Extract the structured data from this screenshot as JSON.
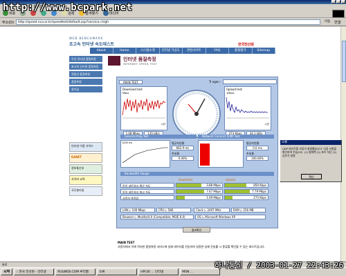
{
  "browser": {
    "menu": [
      "파일(F)",
      "편집(E)",
      "보기(V)",
      "즐겨찾기(A)",
      "도구(T)",
      "도움말(H)"
    ],
    "toolbar": {
      "back": "뒤로",
      "search": "검색",
      "favorites": "즐겨찾기",
      "media": "미디어"
    },
    "address_label": "주소(D)",
    "address": "http://speed.nca.or.kr/speedtest/default.asp?service=high",
    "go": "이동",
    "links": "연결"
  },
  "watermark": {
    "top": "http://www.bcpark.net",
    "bottom": "하나통신 / 2003-01-27 22:43:26"
  },
  "site": {
    "small_title": "WEB BENCHMARK",
    "title": "초고속 인터넷 속도테스트",
    "kt_logo": "한국전산원",
    "nav": [
      "About",
      "Home",
      "시스템소개",
      "인터넷 가상도",
      "관련사이트",
      "FAQ",
      "품질평가",
      "Sitemap"
    ],
    "side_menu": [
      "우선 인터넷 품질측정",
      "초고속 인터넷 품질측정",
      "전용선 품질측정",
      "품질측정",
      "용어집"
    ],
    "side_banners": [
      "인터넷 이용 가이드",
      "KANET",
      "정보통신부",
      "사이버 교육",
      "국무총리실"
    ]
  },
  "test": {
    "section_title": "인터넷 품질측정",
    "section_sub": "INTERNET SPEED TEST",
    "tab": "MAIN TEST",
    "ip_label": "Tr ogan :",
    "download_title": "Download test",
    "download_unit": "Mbps",
    "download_values": [
      "1.08 Mbps",
      "135 kB/s"
    ],
    "upload_title": "Upload test",
    "upload_unit": "1Mbps",
    "upload_values": [
      "273 Kbps",
      "34.1 kB/s"
    ],
    "time_label": "시간",
    "general_ping_title": "General Ping Test",
    "network_ping_title": "Network Connect ICMP Test",
    "ping_label_avg": "평균지연율",
    "ping_avg": "662.9 ms",
    "ping_label_loss": "손실율",
    "ping_loss": "0.00%",
    "ping_y": "1000 ms",
    "net_label_avg": "평균지연율",
    "net_avg": "0.0 ms",
    "net_label_loss": "손실율",
    "net_loss": "100.00%",
    "bandwidth_title": "Bandwidth Gauge",
    "col_download": "Download",
    "col_upload": "Upload",
    "rows": [
      {
        "label": "동일 네트워크 평균 속도",
        "down": "3.88 Mbps",
        "up": "859 Kbps",
        "down_pct": 0.9,
        "up_pct": 0.85
      },
      {
        "label": "동일 네트워크 최고 속도",
        "down": "7.67 Mbps",
        "up": "7.79 Mbps",
        "down_pct": 1.0,
        "up_pct": 1.0
      },
      {
        "label": "사용자 측정값",
        "down": "1.09 Mbps",
        "up": "273 Kbps",
        "down_pct": 0.3,
        "up_pct": 0.3
      }
    ],
    "lan": "LAN ▷ 100 Mbps",
    "cpu": "CPU ▷ 586",
    "clock": "Clock ▷ 2497 MHz",
    "ram": "RAM ▷ 256 MB",
    "browser": "Browser ▷ Mozilla/4.0 (Compatible; MSIE 6.0)",
    "os": "OS ▷ Microsoft Windows XP",
    "result_button": "결과확인",
    "notes_title": "MAIN TEST",
    "notes_text": "사용자에서 이에 적지한 품질측정 서비스에 실제 데이터를 전송하여 일정한 실제 전송률 시 종류를 확인할 수 있는 테스트입니다."
  },
  "dialog": {
    "title": "오류",
    "text": "UDP 테스트중 오류가 발생했습니다. 다음 사항을 확인하여 주십시오. (1) 방화벽 (2) 포트 차단 (3) 공유기 설정",
    "ok": "확인"
  },
  "status": "완료",
  "taskbar": {
    "start": "시작",
    "tasks": [
      ":: 한국 전산원 - 인터넷",
      "RULWEB.COM 루리웹",
      "오류",
      "HP(30 ... 인터넷",
      "MSN ..."
    ]
  }
}
